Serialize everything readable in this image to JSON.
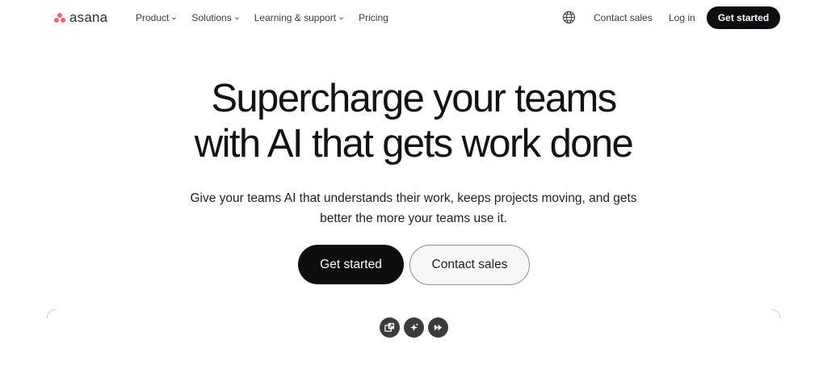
{
  "brand": {
    "name": "asana",
    "logo_color": "#f06a6a"
  },
  "nav": {
    "items": [
      {
        "label": "Product",
        "icon": "chevron-down-icon"
      },
      {
        "label": "Solutions",
        "icon": "chevron-down-icon"
      },
      {
        "label": "Learning & support",
        "icon": "chevron-down-icon"
      },
      {
        "label": "Pricing"
      }
    ],
    "language_icon": "globe-icon",
    "contact_sales": "Contact sales",
    "log_in": "Log in",
    "get_started": "Get started"
  },
  "hero": {
    "headline_line1": "Supercharge your teams",
    "headline_line2": "with AI that gets work done",
    "subtitle_line1": "Give your teams AI that understands their work, keeps projects moving, and gets",
    "subtitle_line2": "better the more your teams use it.",
    "primary_cta": "Get started",
    "secondary_cta": "Contact sales"
  },
  "feature_icons": [
    "workflow-icon",
    "ai-sparkle-icon",
    "fast-forward-icon"
  ],
  "colors": {
    "dark": "#0d0e10",
    "accent": "#f06a6a",
    "text": "#1e1f21"
  }
}
